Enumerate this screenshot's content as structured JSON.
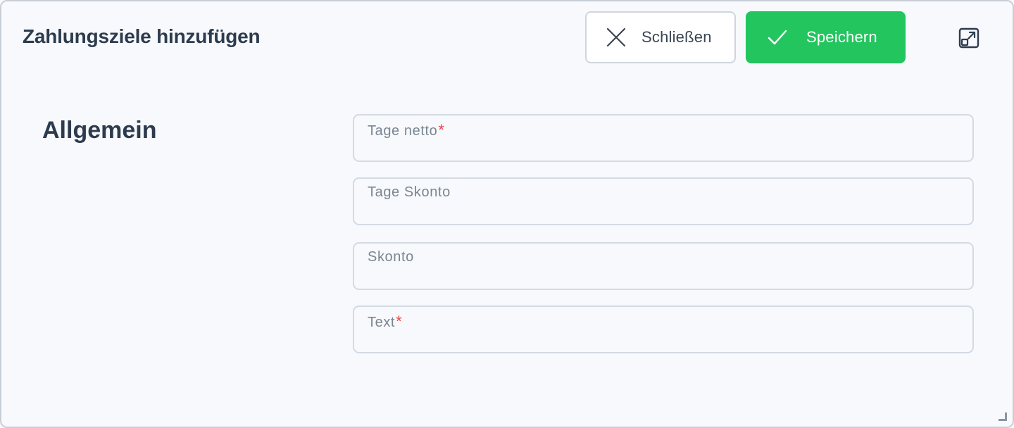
{
  "dialog": {
    "title": "Zahlungsziele hinzufügen",
    "close_label": "Schließen",
    "save_label": "Speichern",
    "close_icon": "close-icon",
    "save_icon": "check-icon",
    "expand_icon": "expand-icon",
    "colors": {
      "save_bg": "#22c55e",
      "required": "#ef4444",
      "title": "#2d3b4e"
    }
  },
  "section": {
    "title": "Allgemein"
  },
  "fields": [
    {
      "label": "Tage netto",
      "required": true,
      "required_mark": "*",
      "value": ""
    },
    {
      "label": "Tage Skonto",
      "required": false,
      "value": ""
    },
    {
      "label": "Skonto",
      "required": false,
      "value": ""
    },
    {
      "label": "Text",
      "required": true,
      "required_mark": "*",
      "value": ""
    }
  ]
}
